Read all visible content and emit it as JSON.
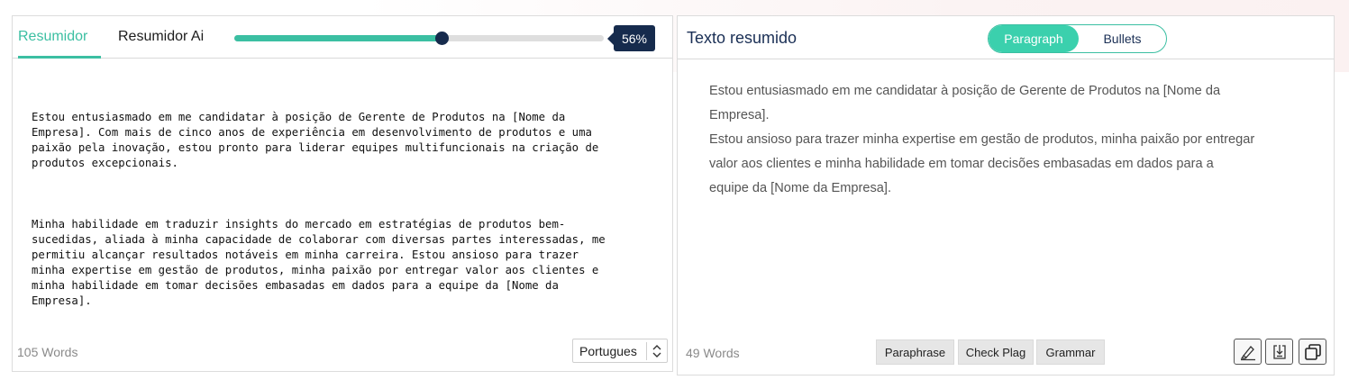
{
  "left_panel": {
    "tabs": [
      {
        "label": "Resumidor",
        "active": true
      },
      {
        "label": "Resumidor Ai",
        "active": false
      }
    ],
    "slider": {
      "value_percent": 56,
      "label": "56%"
    },
    "input_paragraphs": [
      "Estou entusiasmado em me candidatar à posição de Gerente de Produtos na [Nome da\nEmpresa]. Com mais de cinco anos de experiência em desenvolvimento de produtos e uma\npaixão pela inovação, estou pronto para liderar equipes multifuncionais na criação de\nprodutos excepcionais.",
      "Minha habilidade em traduzir insights do mercado em estratégias de produtos bem-\nsucedidas, aliada à minha capacidade de colaborar com diversas partes interessadas, me\npermitiu alcançar resultados notáveis em minha carreira. Estou ansioso para trazer\nminha expertise em gestão de produtos, minha paixão por entregar valor aos clientes e\nminha habilidade em tomar decisões embasadas em dados para a equipe da [Nome da\nEmpresa]."
    ],
    "word_count": "105 Words",
    "language": "Portugues"
  },
  "right_panel": {
    "title": "Texto resumido",
    "toggle": {
      "paragraph": "Paragraph",
      "bullets": "Bullets",
      "selected": "Paragraph"
    },
    "output_lines": [
      "Estou entusiasmado em me candidatar à posição de Gerente de Produtos na [Nome da",
      "Empresa].",
      "Estou ansioso para trazer minha expertise em gestão de produtos, minha paixão por entregar",
      "valor aos clientes e minha habilidade em tomar decisões embasadas em dados para a",
      "equipe da [Nome da Empresa]."
    ],
    "word_count": "49 Words",
    "actions": {
      "paraphrase": "Paraphrase",
      "check_plag": "Check Plag",
      "grammar": "Grammar"
    },
    "icons": [
      "highlighter-icon",
      "download-icon",
      "copy-icon"
    ]
  },
  "colors": {
    "accent": "#3bbfa2",
    "navy": "#162b4d",
    "toggle_on": "#3bd0ad"
  }
}
